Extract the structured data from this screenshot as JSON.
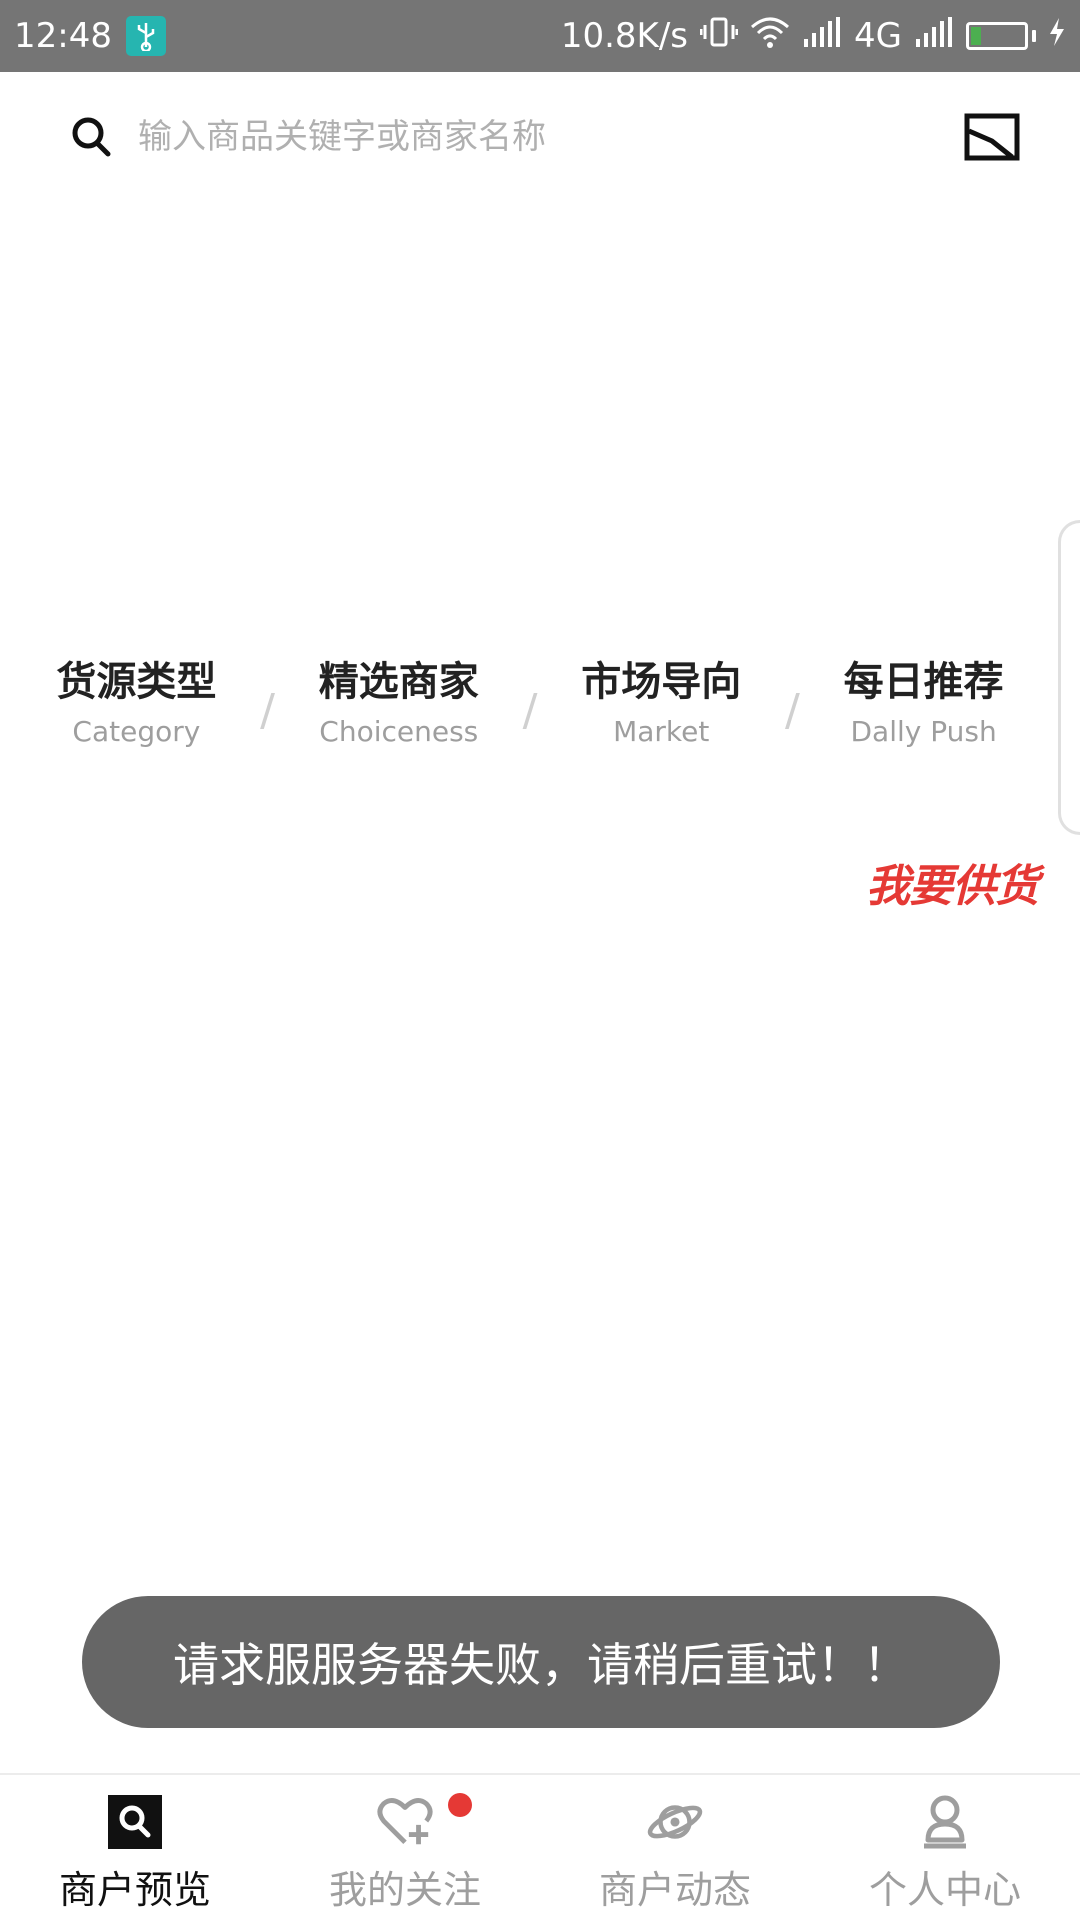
{
  "status_bar": {
    "time": "12:48",
    "network_speed": "10.8K/s",
    "network_type": "4G",
    "icons": [
      "usb-icon",
      "vibrate-icon",
      "wifi-icon",
      "signal-icon",
      "battery-icon",
      "charging-icon"
    ],
    "battery_fill_fraction": 0.2
  },
  "search": {
    "placeholder": "输入商品关键字或商家名称"
  },
  "categories": [
    {
      "title": "货源类型",
      "subtitle": "Category"
    },
    {
      "title": "精选商家",
      "subtitle": "Choiceness"
    },
    {
      "title": "市场导向",
      "subtitle": "Market"
    },
    {
      "title": "每日推荐",
      "subtitle": "Dally Push"
    }
  ],
  "separator": "/",
  "supply_button": {
    "label": "我要供货",
    "color": "#e53935"
  },
  "toast": {
    "message": "请求服服务器失败，请稍后重试！！"
  },
  "bottom_nav": {
    "items": [
      {
        "label": "商户预览",
        "icon": "search-icon",
        "active": true
      },
      {
        "label": "我的关注",
        "icon": "heart-plus-icon",
        "active": false,
        "badge": true
      },
      {
        "label": "商户动态",
        "icon": "planet-icon",
        "active": false
      },
      {
        "label": "个人中心",
        "icon": "user-icon",
        "active": false
      }
    ]
  },
  "colors": {
    "status_bar": "#757575",
    "accent_red": "#e53935",
    "usb_badge": "#26b5b0",
    "toast_bg": "#666666"
  }
}
